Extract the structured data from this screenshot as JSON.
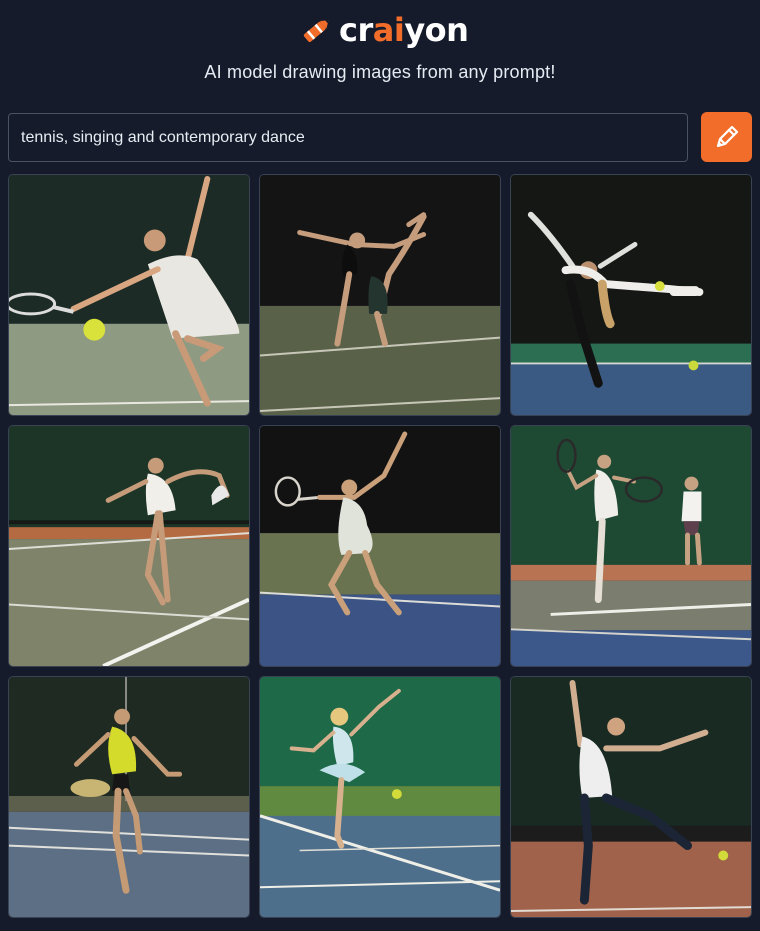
{
  "header": {
    "logo_part1": "cr",
    "logo_part2": "ai",
    "logo_part3": "yon",
    "tagline": "AI model drawing images from any prompt!"
  },
  "search": {
    "value": "tennis, singing and contemporary dance",
    "button_icon": "pencil-icon"
  },
  "colors": {
    "background": "#151b2a",
    "accent": "#f26d2a",
    "border": "#4a5364"
  },
  "results": [
    {
      "name": "result-image-1"
    },
    {
      "name": "result-image-2"
    },
    {
      "name": "result-image-3"
    },
    {
      "name": "result-image-4"
    },
    {
      "name": "result-image-5"
    },
    {
      "name": "result-image-6"
    },
    {
      "name": "result-image-7"
    },
    {
      "name": "result-image-8"
    },
    {
      "name": "result-image-9"
    }
  ]
}
